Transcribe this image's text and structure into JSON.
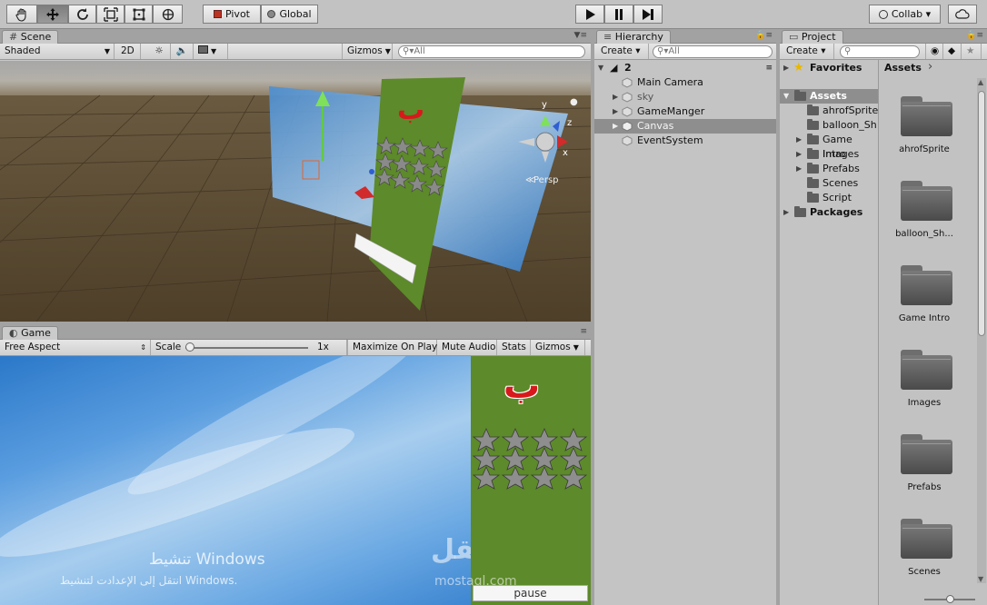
{
  "toolbar": {
    "pivot_label": "Pivot",
    "global_label": "Global",
    "collab_label": "Collab ▾"
  },
  "scene": {
    "tab_label": "Scene",
    "shading": "Shaded",
    "mode_2d": "2D",
    "gizmos": "Gizmos",
    "search_placeholder": "All",
    "persp_label": "Persp",
    "axis_y": "y",
    "axis_x": "x",
    "axis_z": "z",
    "letter": "ب"
  },
  "game": {
    "tab_label": "Game",
    "aspect": "Free Aspect",
    "scale_label": "Scale",
    "scale_value": "1x",
    "maximize": "Maximize On Play",
    "mute": "Mute Audio",
    "stats": "Stats",
    "gizmos": "Gizmos",
    "letter": "ب",
    "pause_label": "pause",
    "watermark_title": "تنشيط Windows",
    "watermark_sub": "انتقل إلى الإعدادت لتنشيط Windows.",
    "brand_arabic": "مستقل",
    "brand_latin": "mostaql.com"
  },
  "hierarchy": {
    "tab_label": "Hierarchy",
    "create": "Create ▾",
    "search_placeholder": "All",
    "scene_name": "2",
    "items": [
      {
        "label": "Main Camera"
      },
      {
        "label": "sky"
      },
      {
        "label": "GameManger"
      },
      {
        "label": "Canvas"
      },
      {
        "label": "EventSystem"
      }
    ]
  },
  "project": {
    "tab_label": "Project",
    "create": "Create ▾",
    "favorites": "Favorites",
    "assets_header": "Assets",
    "breadcrumb_arrow": "›",
    "tree": [
      {
        "label": "Assets"
      },
      {
        "label": "ahrofSprite"
      },
      {
        "label": "balloon_Sh"
      },
      {
        "label": "Game Intro"
      },
      {
        "label": "Images"
      },
      {
        "label": "Prefabs"
      },
      {
        "label": "Scenes"
      },
      {
        "label": "Script"
      },
      {
        "label": "Packages"
      }
    ],
    "folders": [
      {
        "label": "ahrofSprite"
      },
      {
        "label": "balloon_Sh..."
      },
      {
        "label": "Game Intro"
      },
      {
        "label": "Images"
      },
      {
        "label": "Prefabs"
      },
      {
        "label": "Scenes"
      }
    ]
  },
  "colors": {
    "accent_green": "#5d8a2a",
    "letter_red": "#cc1515",
    "ground": "#574731"
  }
}
